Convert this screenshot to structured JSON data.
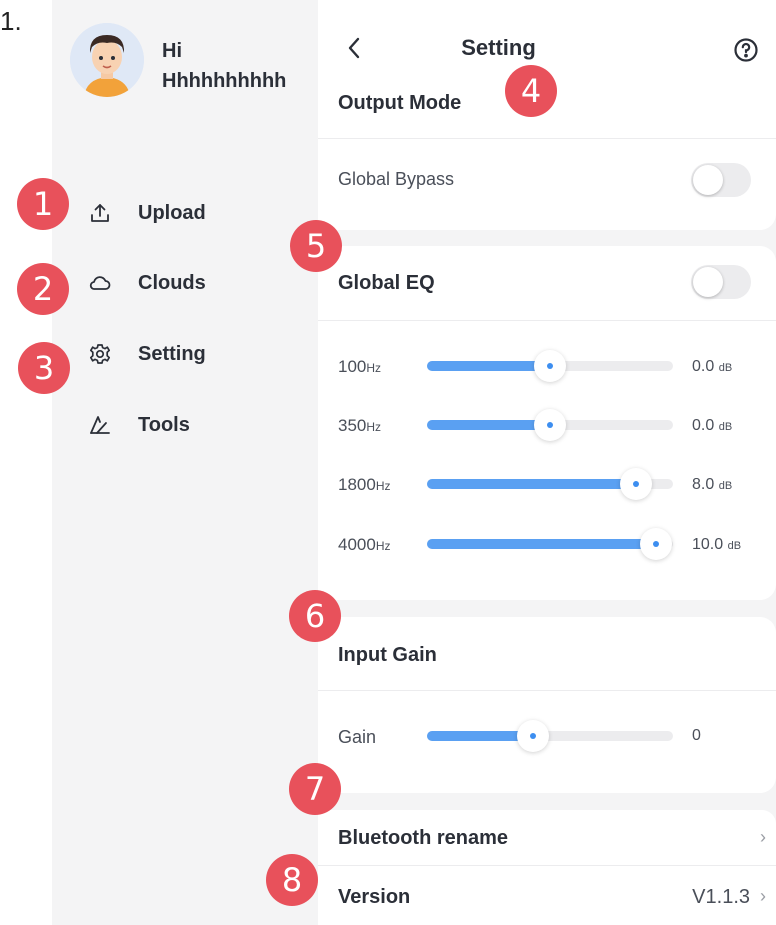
{
  "corner_text": "1.",
  "user": {
    "greeting": "Hi",
    "name": "Hhhhhhhhhh"
  },
  "sidebar": {
    "items": [
      {
        "label": "Upload",
        "icon": "upload-icon"
      },
      {
        "label": "Clouds",
        "icon": "cloud-icon"
      },
      {
        "label": "Setting",
        "icon": "gear-icon"
      },
      {
        "label": "Tools",
        "icon": "tools-icon"
      }
    ]
  },
  "header": {
    "title": "Setting",
    "back_icon": "chevron-left-icon",
    "help_icon": "question-circle-icon"
  },
  "output_mode": {
    "title": "Output Mode",
    "global_bypass_label": "Global Bypass",
    "global_bypass_on": false
  },
  "global_eq": {
    "title": "Global EQ",
    "enabled": false,
    "bands": [
      {
        "freq": "100",
        "freq_unit": "Hz",
        "value": "0.0",
        "value_unit": "dB",
        "level": 0.5
      },
      {
        "freq": "350",
        "freq_unit": "Hz",
        "value": "0.0",
        "value_unit": "dB",
        "level": 0.5
      },
      {
        "freq": "1800",
        "freq_unit": "Hz",
        "value": "8.0",
        "value_unit": "dB",
        "level": 0.85
      },
      {
        "freq": "4000",
        "freq_unit": "Hz",
        "value": "10.0",
        "value_unit": "dB",
        "level": 0.93
      }
    ]
  },
  "input_gain": {
    "title": "Input Gain",
    "gain_label": "Gain",
    "gain_value": "0",
    "level": 0.43
  },
  "bluetooth_rename": {
    "label": "Bluetooth rename"
  },
  "version": {
    "label": "Version",
    "value": "V1.1.3"
  },
  "badges": [
    "1",
    "2",
    "3",
    "4",
    "5",
    "6",
    "7",
    "8"
  ],
  "colors": {
    "accent": "#5aa0f2",
    "badge": "#e8515b",
    "background": "#f4f4f5"
  }
}
